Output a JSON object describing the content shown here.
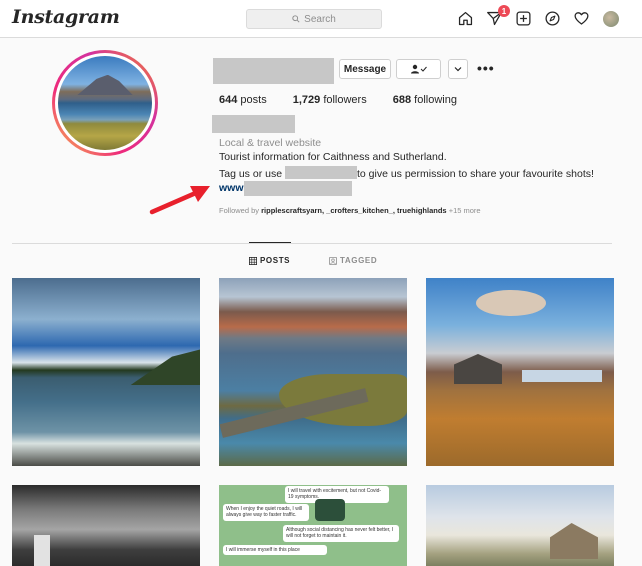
{
  "nav": {
    "logo": "Instagram",
    "search_placeholder": "Search",
    "activity_badge": "1",
    "icons": [
      "home-icon",
      "direct-messages-icon",
      "new-post-icon",
      "explore-icon",
      "activity-heart-icon",
      "profile-avatar"
    ]
  },
  "profile": {
    "buttons": {
      "message": "Message",
      "follow_icon": "person-check-icon",
      "dropdown_icon": "chevron-down-icon",
      "more": "•••"
    },
    "stats": {
      "posts_count": "644",
      "posts_label": "posts",
      "followers_count": "1,729",
      "followers_label": "followers",
      "following_count": "688",
      "following_label": "following"
    },
    "category": "Local & travel website",
    "bio_line1": "Tourist information for Caithness and Sutherland.",
    "bio_line2_before": "Tag us or use",
    "bio_line2_after": "to give us permission to share your favourite shots!",
    "link_prefix": "www",
    "followed_by_prefix": "Followed by",
    "followed_by_names": "ripplescraftsyarn, _crofters_kitchen_, truehighlands",
    "followed_by_more": "+15 more"
  },
  "tabs": {
    "posts": "POSTS",
    "tagged": "TAGGED",
    "active": "posts"
  },
  "post_text": {
    "line1": "I will travel with excitement, but not Covid-19 symptoms.",
    "line2": "When I enjoy the quiet roads, I will always give way to faster traffic.",
    "line3": "Although social distancing has never felt better, I will not forget to maintain it.",
    "line4": "I will immerse myself in this place"
  },
  "colors": {
    "annotation_arrow": "#e8202c",
    "link": "#003569",
    "badge": "#ed4956"
  }
}
